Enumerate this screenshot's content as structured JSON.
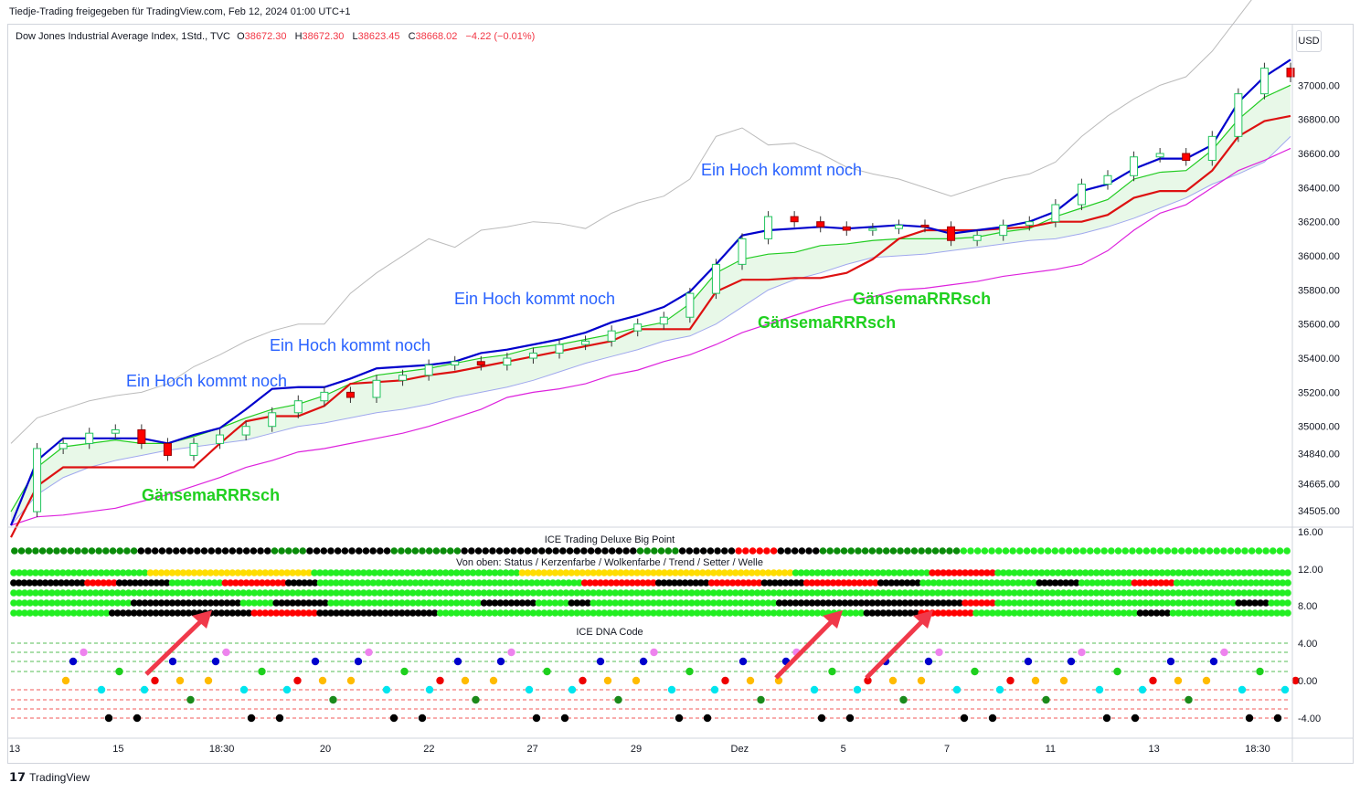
{
  "header": {
    "shared_by": "Tiedje-Trading freigegeben für TradingView.com, Feb 12, 2024 01:00 UTC+1"
  },
  "legend": {
    "symbol": "Dow Jones Industrial Average Index, 1Std., TVC",
    "o_key": "O",
    "o": "38672.30",
    "h_key": "H",
    "h": "38672.30",
    "l_key": "L",
    "l": "38623.45",
    "c_key": "C",
    "c": "38668.02",
    "change": "−4.22 (−0.01%)"
  },
  "currency": "USD",
  "footer": {
    "brand": "TradingView"
  },
  "colors": {
    "up": "#22c55e",
    "down": "#ff0000",
    "blue_line": "#0000cc",
    "red_line": "#dd1111",
    "green_line": "#22cc22",
    "cloud": "#e8f8e8",
    "magenta": "#dd22dd",
    "upper": "#bbbbbb",
    "annotation": "#2962ff",
    "arrow": "#f0394a"
  },
  "chart_data": [
    {
      "type": "line",
      "panel": "price",
      "ylim": [
        34420,
        37350
      ],
      "y_ticks": [
        "37000.00",
        "36800.00",
        "36600.00",
        "36400.00",
        "36200.00",
        "36000.00",
        "35800.00",
        "35600.00",
        "35400.00",
        "35200.00",
        "35000.00",
        "34840.00",
        "34665.00",
        "34505.00"
      ],
      "x_ticks": [
        "13",
        "15",
        "18:30",
        "20",
        "22",
        "27",
        "29",
        "Dez",
        "5",
        "7",
        "11",
        "13",
        "18:30"
      ],
      "annotations": [
        "Ein Hoch kommt noch",
        "Ein Hoch kommt noch",
        "Ein Hoch kommt noch",
        "Ein Hoch kommt noch",
        "GänsemaRRRsch",
        "GänsemaRRRsch",
        "GänsemaRRRsch"
      ],
      "series": [
        {
          "role": "close",
          "values": [
            34500,
            34870,
            34900,
            34960,
            34980,
            34900,
            34830,
            34900,
            34950,
            35000,
            35080,
            35150,
            35200,
            35170,
            35270,
            35300,
            35360,
            35380,
            35360,
            35400,
            35430,
            35480,
            35500,
            35560,
            35600,
            35640,
            35780,
            35950,
            36100,
            36230,
            36200,
            36170,
            36150,
            36160,
            36180,
            36170,
            36090,
            36120,
            36180,
            36200,
            36300,
            36420,
            36470,
            36580,
            36600,
            36560,
            36700,
            36950,
            37100,
            37050
          ]
        },
        {
          "role": "blue_line",
          "values": [
            34420,
            34800,
            34930,
            34930,
            34930,
            34930,
            34900,
            34950,
            34990,
            35100,
            35220,
            35230,
            35230,
            35280,
            35340,
            35350,
            35360,
            35380,
            35430,
            35450,
            35480,
            35510,
            35550,
            35610,
            35650,
            35700,
            35790,
            35950,
            36120,
            36150,
            36160,
            36170,
            36160,
            36170,
            36180,
            36170,
            36130,
            36150,
            36170,
            36200,
            36260,
            36380,
            36420,
            36510,
            36570,
            36570,
            36650,
            36900,
            37050,
            37150
          ]
        },
        {
          "role": "red_line",
          "values": [
            34350,
            34650,
            34760,
            34760,
            34760,
            34760,
            34760,
            34760,
            34900,
            35030,
            35060,
            35060,
            35120,
            35250,
            35260,
            35270,
            35300,
            35320,
            35350,
            35380,
            35410,
            35440,
            35470,
            35500,
            35570,
            35570,
            35570,
            35790,
            35860,
            35860,
            35870,
            35870,
            35900,
            35980,
            36100,
            36150,
            36150,
            36150,
            36160,
            36170,
            36200,
            36200,
            36240,
            36340,
            36380,
            36380,
            36500,
            36700,
            36790,
            36820
          ]
        },
        {
          "role": "green_line",
          "values": [
            34500,
            34760,
            34880,
            34900,
            34920,
            34900,
            34900,
            34940,
            34990,
            35050,
            35100,
            35130,
            35180,
            35250,
            35300,
            35320,
            35340,
            35370,
            35400,
            35420,
            35460,
            35480,
            35510,
            35540,
            35580,
            35610,
            35720,
            35900,
            35980,
            36010,
            36020,
            36060,
            36070,
            36090,
            36100,
            36100,
            36100,
            36110,
            36140,
            36160,
            36230,
            36280,
            36330,
            36450,
            36490,
            36500,
            36620,
            36800,
            36930,
            37000
          ]
        },
        {
          "role": "cloud_lower",
          "values": [
            34420,
            34600,
            34700,
            34760,
            34800,
            34830,
            34860,
            34880,
            34900,
            34920,
            34960,
            35000,
            35020,
            35050,
            35080,
            35100,
            35130,
            35170,
            35200,
            35230,
            35270,
            35320,
            35370,
            35410,
            35450,
            35500,
            35530,
            35600,
            35700,
            35800,
            35860,
            35900,
            35950,
            35990,
            36000,
            36010,
            36030,
            36050,
            36070,
            36090,
            36100,
            36130,
            36170,
            36220,
            36280,
            36340,
            36420,
            36480,
            36550,
            36700
          ]
        },
        {
          "role": "magenta_line",
          "values": [
            34420,
            34470,
            34480,
            34500,
            34520,
            34560,
            34600,
            34650,
            34700,
            34760,
            34800,
            34850,
            34870,
            34900,
            34930,
            34960,
            35000,
            35050,
            35100,
            35170,
            35200,
            35220,
            35250,
            35300,
            35330,
            35380,
            35420,
            35480,
            35550,
            35600,
            35650,
            35700,
            35740,
            35760,
            35800,
            35810,
            35830,
            35850,
            35880,
            35900,
            35920,
            35950,
            36030,
            36150,
            36250,
            36300,
            36400,
            36500,
            36560,
            36630
          ]
        },
        {
          "role": "upper_band",
          "values": [
            34900,
            35050,
            35100,
            35150,
            35180,
            35200,
            35250,
            35350,
            35420,
            35500,
            35560,
            35600,
            35600,
            35780,
            35900,
            36000,
            36100,
            36050,
            36150,
            36170,
            36200,
            36190,
            36160,
            36250,
            36310,
            36350,
            36450,
            36700,
            36750,
            36650,
            36660,
            36600,
            36520,
            36480,
            36450,
            36400,
            36350,
            36400,
            36450,
            36480,
            36550,
            36700,
            36820,
            36920,
            37000,
            37050,
            37200,
            37400,
            37600,
            37800
          ]
        }
      ]
    },
    {
      "type": "scatter",
      "panel": "ICE Trading Deluxe Big Point",
      "title": "ICE Trading Deluxe Big Point",
      "subtitle": "Von oben: Status / Kerzenfarbe / Wolkenfarbe / Trend / Setter / Welle",
      "y_ticks": [
        "16.00",
        "12.00",
        "8.00"
      ],
      "rows": [
        {
          "row": "Status",
          "runs": [
            [
              "#0a8c0a",
              18
            ],
            [
              "#000000",
              19
            ],
            [
              "#0a8c0a",
              5
            ],
            [
              "#000000",
              12
            ],
            [
              "#0a8c0a",
              10
            ],
            [
              "#000000",
              25
            ],
            [
              "#0a8c0a",
              6
            ],
            [
              "#000000",
              8
            ],
            [
              "#ff0000",
              6
            ],
            [
              "#000000",
              6
            ],
            [
              "#0a8c0a",
              20
            ],
            [
              "#22ee22",
              47
            ]
          ]
        },
        {
          "row": "Kerzenfarbe",
          "runs": [
            [
              "#22ee22",
              25
            ],
            [
              "#ffdd00",
              30
            ],
            [
              "#22ee22",
              38
            ],
            [
              "#ffdd00",
              50
            ],
            [
              "#22ee22",
              25
            ],
            [
              "#ff0000",
              12
            ],
            [
              "#22ee22",
              54
            ]
          ]
        },
        {
          "row": "Wolkenfarbe",
          "runs": [
            [
              "#000000",
              14
            ],
            [
              "#ff0000",
              6
            ],
            [
              "#000000",
              10
            ],
            [
              "#22ee22",
              10
            ],
            [
              "#ff0000",
              12
            ],
            [
              "#000000",
              6
            ],
            [
              "#22ee22",
              50
            ],
            [
              "#ff0000",
              14
            ],
            [
              "#000000",
              10
            ],
            [
              "#ff0000",
              10
            ],
            [
              "#000000",
              8
            ],
            [
              "#ff0000",
              14
            ],
            [
              "#000000",
              8
            ],
            [
              "#22ee22",
              22
            ],
            [
              "#000000",
              8
            ],
            [
              "#22ee22",
              10
            ],
            [
              "#ff0000",
              8
            ],
            [
              "#22ee22",
              22
            ]
          ]
        },
        {
          "row": "Trend",
          "runs": [
            [
              "#22ee22",
              234
            ]
          ]
        },
        {
          "row": "Setter",
          "runs": [
            [
              "#22ee22",
              22
            ],
            [
              "#000000",
              20
            ],
            [
              "#22ee22",
              6
            ],
            [
              "#000000",
              10
            ],
            [
              "#22ee22",
              28
            ],
            [
              "#000000",
              10
            ],
            [
              "#22ee22",
              6
            ],
            [
              "#000000",
              4
            ],
            [
              "#22ee22",
              34
            ],
            [
              "#000000",
              34
            ],
            [
              "#ff0000",
              6
            ],
            [
              "#22ee22",
              44
            ],
            [
              "#000000",
              6
            ],
            [
              "#22ee22",
              4
            ]
          ]
        },
        {
          "row": "Welle",
          "runs": [
            [
              "#22ee22",
              18
            ],
            [
              "#000000",
              26
            ],
            [
              "#ff0000",
              12
            ],
            [
              "#000000",
              22
            ],
            [
              "#22ee22",
              78
            ],
            [
              "#000000",
              10
            ],
            [
              "#ff0000",
              10
            ],
            [
              "#22ee22",
              30
            ],
            [
              "#000000",
              6
            ],
            [
              "#22ee22",
              22
            ]
          ]
        }
      ]
    },
    {
      "type": "scatter",
      "panel": "ICE DNA Code",
      "title": "ICE DNA Code",
      "y_ticks": [
        "4.00",
        "0.00",
        "-4.00"
      ]
    }
  ]
}
